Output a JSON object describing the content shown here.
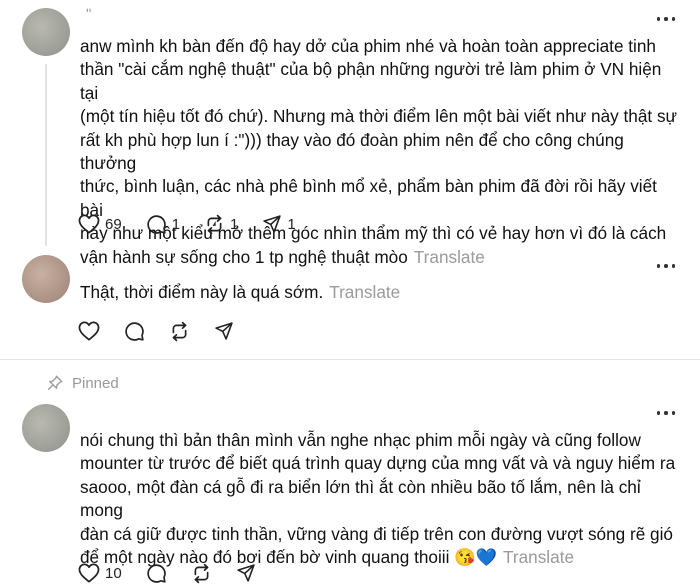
{
  "posts": [
    {
      "username": "ʺ",
      "text": "anw mình kh bàn đến độ hay dở của phim nhé và hoàn toàn appreciate tinh\nthần \"cài cắm nghệ thuật\" của bộ phận những người trẻ làm phim ở VN hiện tại\n(một tín hiệu tốt đó chứ). Nhưng mà thời điểm lên một bài viết như này thật sự\nrất kh phù hợp lun í :\")))  thay vào đó đoàn phim nên để cho công chúng thưởng\nthức, bình luận, các nhà phê bình mổ xẻ, phẩm bàn phim đã đời rồi hãy viết bài\nnày như một kiểu mở thêm góc nhìn thẩm mỹ thì có vẻ hay hơn vì đó là cách\nvận hành sự sống cho 1 tp nghệ thuật mòo",
      "translate": "Translate",
      "likes": "69",
      "replies": "1",
      "reposts": "1",
      "shares": "1"
    },
    {
      "text": "Thật, thời điểm này là quá sớm.",
      "translate": "Translate"
    },
    {
      "pinned_label": "Pinned",
      "text": "nói chung thì bản thân mình vẫn nghe nhạc phim mỗi ngày và cũng follow\nmounter từ trước để biết quá trình quay dựng của mng vất và và nguy hiểm ra\nsaooo, một đàn cá gỗ đi ra biển lớn thì ắt còn nhiều bão tố lắm, nên là chỉ mong\nđàn cá giữ được tinh thần, vững vàng đi tiếp trên con đường vượt sóng rẽ gió\nđể một ngày nào đó bơi đến bờ vinh quang thoiii",
      "emoji": "😘💙",
      "translate": "Translate",
      "likes": "10"
    }
  ],
  "icons": {
    "like": "heart-icon",
    "reply": "comment-icon",
    "repost": "repost-icon",
    "share": "share-icon",
    "more": "more-icon",
    "pin": "pin-icon"
  }
}
